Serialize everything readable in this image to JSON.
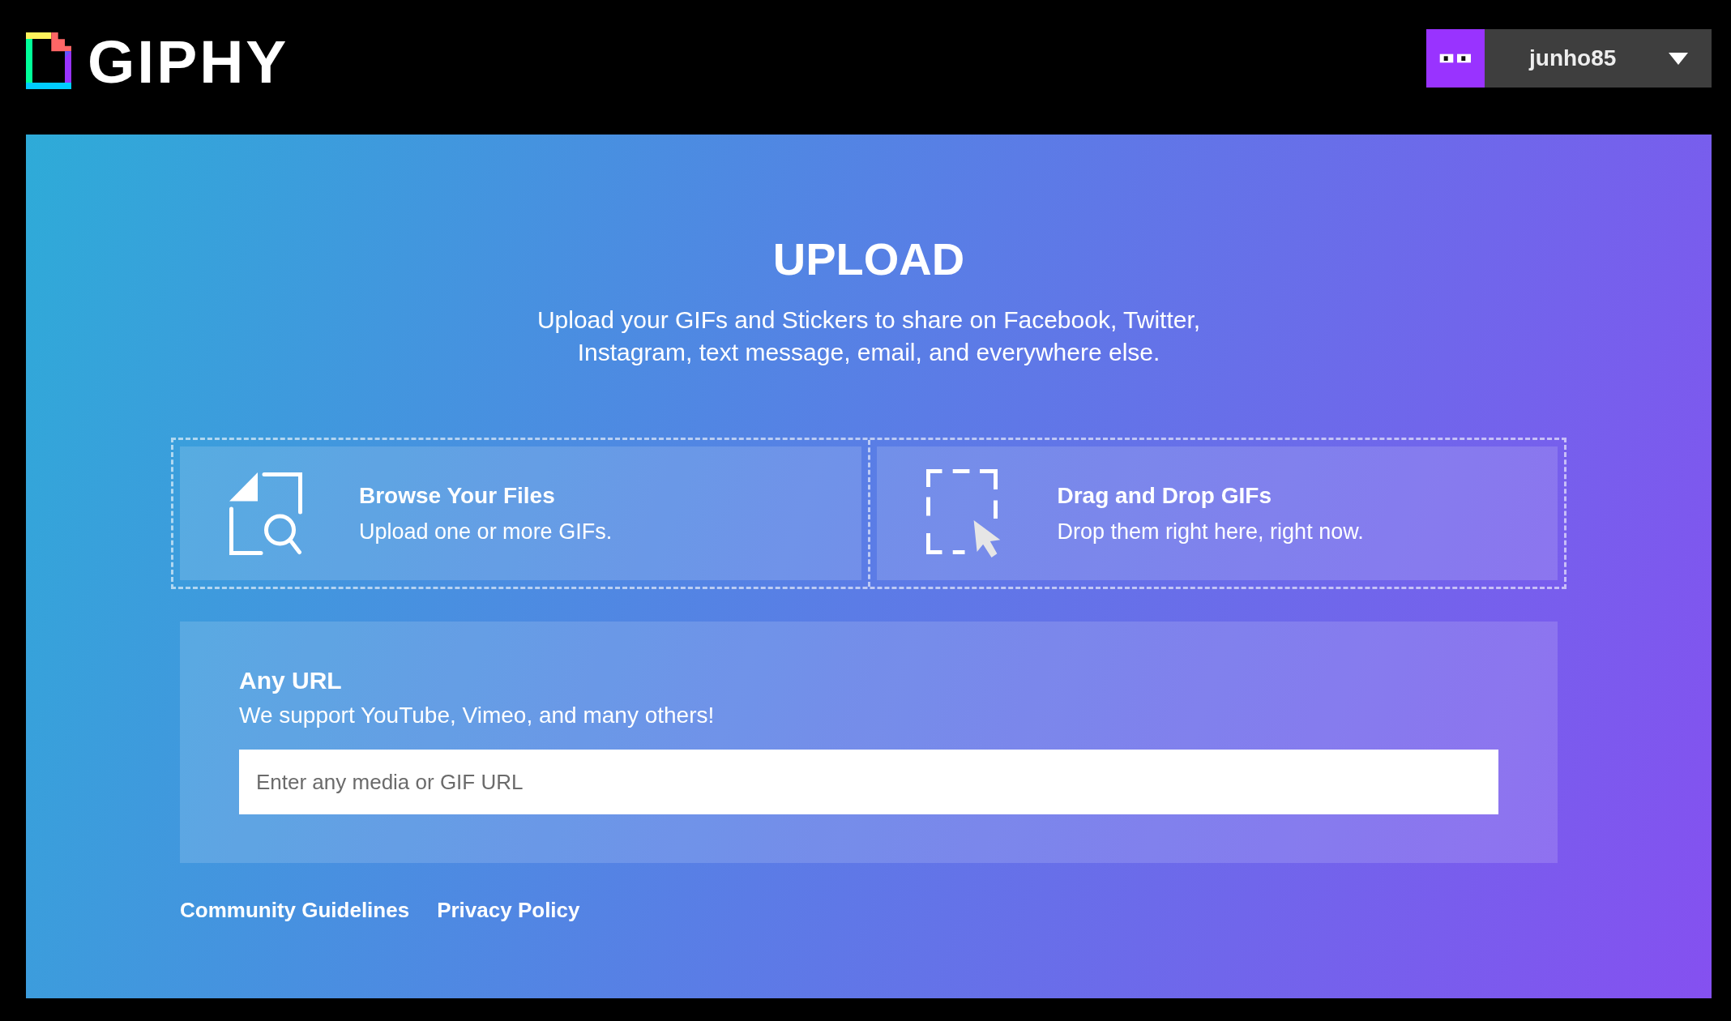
{
  "header": {
    "logo": {
      "text": "GIPHY"
    },
    "user_menu": {
      "username": "junho85"
    }
  },
  "upload": {
    "title": "UPLOAD",
    "description": "Upload your GIFs and Stickers to share on Facebook, Twitter, Instagram, text message, email, and everywhere else.",
    "sources": [
      {
        "kind": "browse",
        "title": "Browse Your Files",
        "description": "Upload one or more GIFs."
      },
      {
        "kind": "drag_drop",
        "title": "Drag and Drop GIFs",
        "description": "Drop them right here, right now."
      }
    ],
    "url_import": {
      "title": "Any URL",
      "description": "We support YouTube, Vimeo, and many others!",
      "input": {
        "placeholder": "Enter any media or GIF URL"
      }
    },
    "footer_links": [
      "Community Guidelines",
      "Privacy Policy"
    ]
  }
}
